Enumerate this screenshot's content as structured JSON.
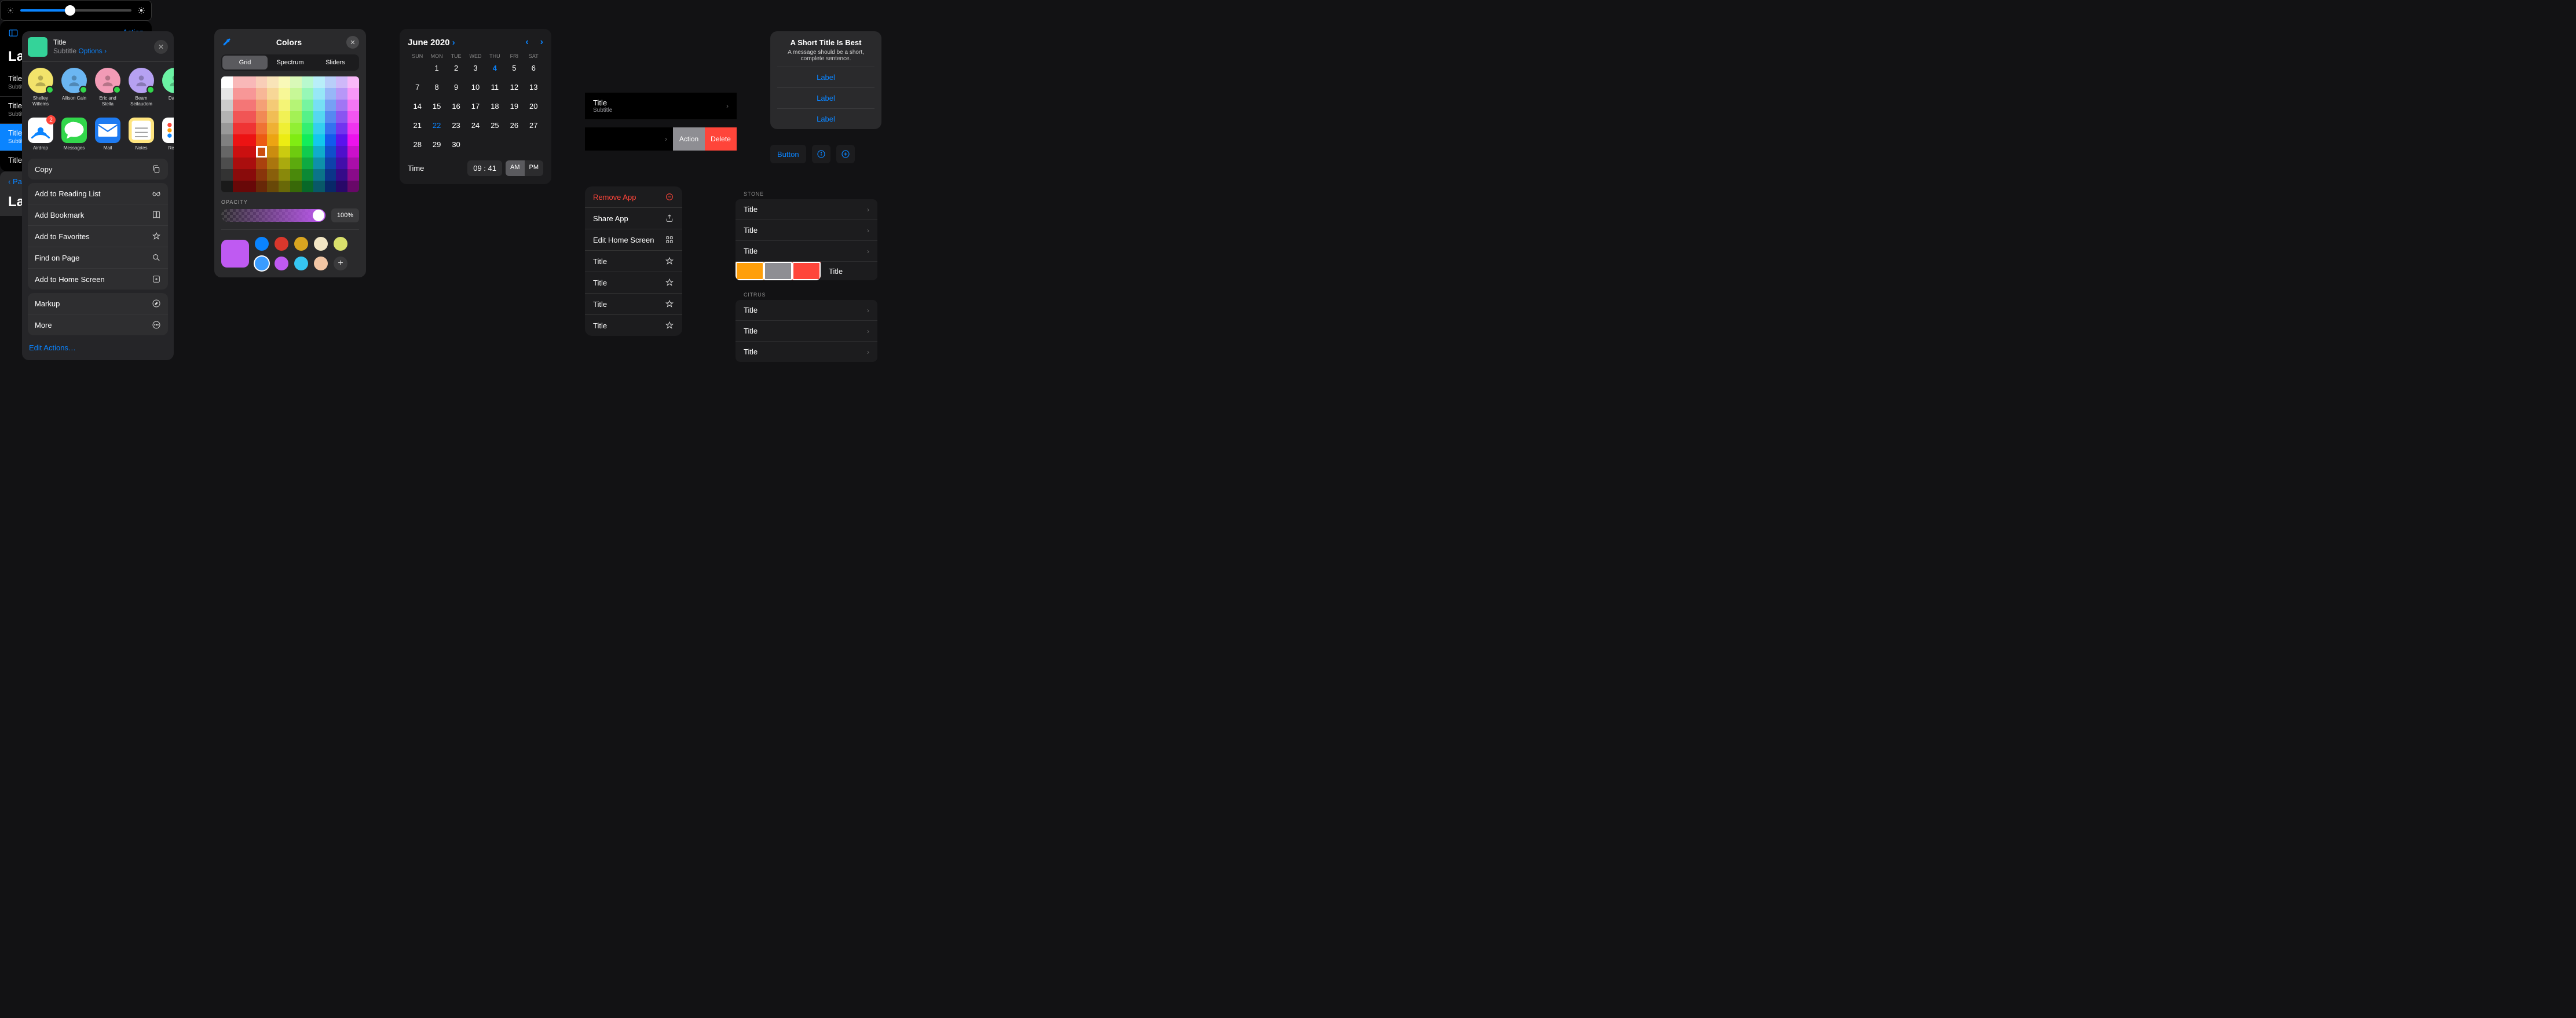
{
  "share": {
    "title": "Title",
    "subtitle": "Subtitle",
    "options": "Options",
    "contacts": [
      {
        "name": "Shelley Willems",
        "color": "#f2e36b"
      },
      {
        "name": "Allison Cain",
        "color": "#6bb6f2"
      },
      {
        "name": "Eric and Stella",
        "color": "#f29bb6"
      },
      {
        "name": "Beam Seilaudom",
        "color": "#b6a1f2"
      },
      {
        "name": "Da Kn",
        "color": "#6bf2a4"
      }
    ],
    "apps": [
      {
        "name": "Airdrop",
        "color": "#ffffff",
        "notif": "2"
      },
      {
        "name": "Messages",
        "color": "#32d74b"
      },
      {
        "name": "Mail",
        "color": "#1e7bf2"
      },
      {
        "name": "Notes",
        "color": "#ffe57f"
      },
      {
        "name": "Remin",
        "color": "#ffffff"
      }
    ],
    "copy": "Copy",
    "actions1": [
      "Add to Reading List",
      "Add Bookmark",
      "Add to Favorites",
      "Find on Page",
      "Add to Home Screen"
    ],
    "icons1": [
      "glasses",
      "book",
      "star",
      "search",
      "plus-square"
    ],
    "actions2": [
      "Markup",
      "More"
    ],
    "icons2": [
      "pencil-circle",
      "ellipsis-circle"
    ],
    "edit": "Edit Actions…"
  },
  "color": {
    "title": "Colors",
    "tabs": [
      "Grid",
      "Spectrum",
      "Sliders"
    ],
    "opacity_label": "OPACITY",
    "opacity": "100%",
    "swatches": [
      "#bf5af2",
      "#0a84ff",
      "#d9372c",
      "#d9a520",
      "#f2e6c4",
      "#d9e06b",
      "#3a9cff",
      "#bf5af2",
      "#36c6f2",
      "#f2c6a4"
    ],
    "add": "+"
  },
  "calendar": {
    "month": "June 2020",
    "dow": [
      "SUN",
      "MON",
      "TUE",
      "WED",
      "THU",
      "FRI",
      "SAT"
    ],
    "days": [
      "",
      "1",
      "2",
      "3",
      "4",
      "5",
      "6",
      "7",
      "8",
      "9",
      "10",
      "11",
      "12",
      "13",
      "14",
      "15",
      "16",
      "17",
      "18",
      "19",
      "20",
      "21",
      "22",
      "23",
      "24",
      "25",
      "26",
      "27",
      "28",
      "29",
      "30"
    ],
    "today": "4",
    "weekend_highlight": "22",
    "time_label": "Time",
    "time": "09 : 41",
    "am": "AM",
    "pm": "PM"
  },
  "list1": {
    "action": "Action",
    "title": "Large Title",
    "items": [
      {
        "t": "Title",
        "s": "Subtitle"
      },
      {
        "t": "Title",
        "s": "Subtitle"
      },
      {
        "t": "Title",
        "s": "Subtitle",
        "sel": true
      },
      {
        "t": "Title",
        "s": ""
      }
    ]
  },
  "nav": {
    "back": "Parent Title",
    "title": "Large Title"
  },
  "navcell": {
    "t": "Title",
    "s": "Subtitle"
  },
  "swipe": {
    "action": "Action",
    "delete": "Delete"
  },
  "menu": {
    "items": [
      {
        "label": "Remove App",
        "icon": "minus-circle",
        "destructive": true
      },
      {
        "label": "Share App",
        "icon": "share"
      },
      {
        "label": "Edit Home Screen",
        "icon": "apps"
      },
      {
        "label": "Title",
        "icon": "star"
      },
      {
        "label": "Title",
        "icon": "star"
      },
      {
        "label": "Title",
        "icon": "star"
      },
      {
        "label": "Title",
        "icon": "star"
      }
    ]
  },
  "alert": {
    "title": "A Short Title Is Best",
    "message": "A message should be a short, complete sentence.",
    "buttons": [
      "Label",
      "Label",
      "Label"
    ]
  },
  "buttons": {
    "b1": "Button"
  },
  "grouped": {
    "sec1": "STONE",
    "sec1_items": [
      "Title",
      "Title",
      "Title"
    ],
    "seg_extra": "Title",
    "sec2": "CITRUS",
    "sec2_items": [
      "Title",
      "Title",
      "Title"
    ],
    "seg_colors": [
      "#ff9f0a",
      "#8e8e93",
      "#ff453a"
    ]
  }
}
